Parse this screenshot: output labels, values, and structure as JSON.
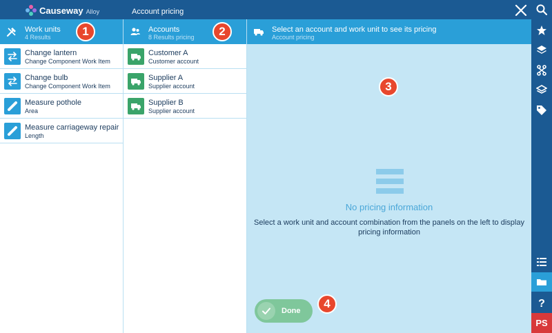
{
  "app": {
    "brand": "Causeway",
    "brand_sub": "Alloy",
    "title": "Account pricing"
  },
  "work_units": {
    "title": "Work units",
    "subtitle": "4 Results",
    "items": [
      {
        "title": "Change lantern",
        "subtitle": "Change Component Work Item",
        "icon": "swap-arrows-icon"
      },
      {
        "title": "Change bulb",
        "subtitle": "Change Component Work Item",
        "icon": "swap-arrows-icon"
      },
      {
        "title": "Measure pothole",
        "subtitle": "Area",
        "icon": "ruler-icon"
      },
      {
        "title": "Measure carriageway repair",
        "subtitle": "Length",
        "icon": "ruler-icon"
      }
    ]
  },
  "accounts": {
    "title": "Accounts",
    "subtitle": "8 Results pricing",
    "items": [
      {
        "title": "Customer A",
        "subtitle": "Customer account",
        "icon": "truck-icon"
      },
      {
        "title": "Supplier A",
        "subtitle": "Supplier account",
        "icon": "truck-icon"
      },
      {
        "title": "Supplier B",
        "subtitle": "Supplier account",
        "icon": "truck-icon"
      }
    ]
  },
  "pricing": {
    "title": "Select an account and work unit to see its pricing",
    "subtitle": "Account pricing",
    "empty_title": "No pricing information",
    "empty_desc": "Select a work unit and account combination from the panels on the left to  display pricing information"
  },
  "actions": {
    "done_label": "Done"
  },
  "badges": [
    "1",
    "2",
    "3",
    "4"
  ],
  "user": {
    "initials": "PS"
  },
  "rail_icons": [
    "search-icon",
    "star-icon",
    "layers-icon",
    "workflow-icon",
    "layers-alt-icon",
    "tag-icon",
    "list-icon",
    "folder-icon",
    "help-icon"
  ],
  "colors": {
    "topbar": "#1b5a93",
    "header": "#2a9fd8",
    "panel": "#c5e6f5",
    "green": "#3aa46a",
    "badge": "#e8472d",
    "user": "#d8393a"
  }
}
